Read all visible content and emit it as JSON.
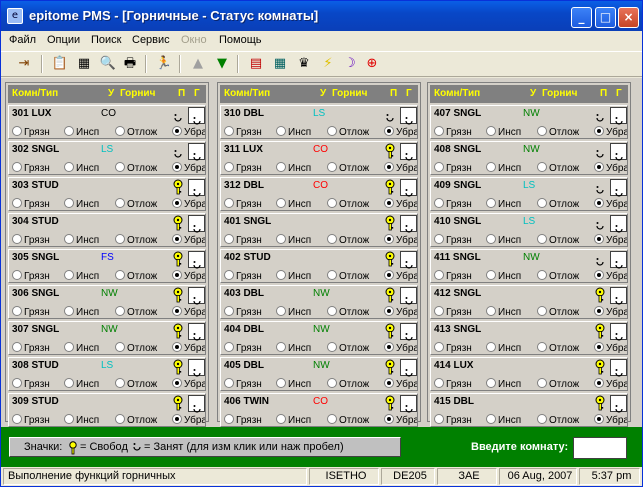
{
  "window": {
    "title": "epitome PMS - [Горничные - Статус комнаты]",
    "min": "_",
    "max": "□",
    "close": "×"
  },
  "menu": [
    "Файл",
    "Опции",
    "Поиск",
    "Сервис",
    "Окно",
    "Помощь"
  ],
  "columns_header": {
    "room": "Комн/Тип",
    "u": "У",
    "maid": "Горнич",
    "p": "П",
    "g": "Г"
  },
  "radio_labels": [
    "Грязн",
    "Инсп",
    "Отлож",
    "Убран"
  ],
  "colors": {
    "code": {
      "CO": "#ff0000",
      "LS": "#00c0c0",
      "NW": "#008000",
      "FS": "#0000ff"
    }
  },
  "rooms": [
    [
      {
        "id": "301 LUX",
        "code": "CO",
        "code_color": "#000000",
        "key": "none",
        "sel": 3
      },
      {
        "id": "302 SNGL",
        "code": "LS",
        "code_color": "#00c0c0",
        "key": "none",
        "sel": 3
      },
      {
        "id": "303 STUD",
        "code": "",
        "code_color": "#000000",
        "key": "key",
        "sel": 3
      },
      {
        "id": "304 STUD",
        "code": "",
        "code_color": "#000000",
        "key": "key",
        "sel": 3
      },
      {
        "id": "305 SNGL",
        "code": "FS",
        "code_color": "#0000ff",
        "key": "key",
        "sel": 3
      },
      {
        "id": "306 SNGL",
        "code": "NW",
        "code_color": "#008000",
        "key": "key",
        "sel": 3
      },
      {
        "id": "307 SNGL",
        "code": "NW",
        "code_color": "#008000",
        "key": "key",
        "sel": 3
      },
      {
        "id": "308 STUD",
        "code": "LS",
        "code_color": "#00c0c0",
        "key": "key",
        "sel": 3
      },
      {
        "id": "309 STUD",
        "code": "",
        "code_color": "#000000",
        "key": "key",
        "sel": 3
      }
    ],
    [
      {
        "id": "310 DBL",
        "code": "LS",
        "code_color": "#00c0c0",
        "key": "none",
        "sel": 3
      },
      {
        "id": "311 LUX",
        "code": "CO",
        "code_color": "#ff0000",
        "key": "key",
        "sel": 3
      },
      {
        "id": "312 DBL",
        "code": "CO",
        "code_color": "#ff0000",
        "key": "key",
        "sel": 3
      },
      {
        "id": "401 SNGL",
        "code": "",
        "code_color": "#000000",
        "key": "key",
        "sel": 3
      },
      {
        "id": "402 STUD",
        "code": "",
        "code_color": "#000000",
        "key": "key",
        "sel": 3
      },
      {
        "id": "403 DBL",
        "code": "NW",
        "code_color": "#008000",
        "key": "key",
        "sel": 3
      },
      {
        "id": "404 DBL",
        "code": "NW",
        "code_color": "#008000",
        "key": "key",
        "sel": 3
      },
      {
        "id": "405 DBL",
        "code": "NW",
        "code_color": "#008000",
        "key": "key",
        "sel": 3
      },
      {
        "id": "406 TWIN",
        "code": "CO",
        "code_color": "#ff0000",
        "key": "key",
        "sel": 3
      }
    ],
    [
      {
        "id": "407 SNGL",
        "code": "NW",
        "code_color": "#008000",
        "key": "none",
        "sel": 3
      },
      {
        "id": "408 SNGL",
        "code": "NW",
        "code_color": "#008000",
        "key": "none",
        "sel": 3
      },
      {
        "id": "409 SNGL",
        "code": "LS",
        "code_color": "#00c0c0",
        "key": "none",
        "sel": 3
      },
      {
        "id": "410 SNGL",
        "code": "LS",
        "code_color": "#00c0c0",
        "key": "none",
        "sel": 3
      },
      {
        "id": "411 SNGL",
        "code": "NW",
        "code_color": "#008000",
        "key": "none",
        "sel": 3
      },
      {
        "id": "412 SNGL",
        "code": "",
        "code_color": "#000000",
        "key": "key",
        "sel": 3
      },
      {
        "id": "413 SNGL",
        "code": "",
        "code_color": "#000000",
        "key": "key",
        "sel": 3
      },
      {
        "id": "414 LUX",
        "code": "",
        "code_color": "#000000",
        "key": "key",
        "sel": 3
      },
      {
        "id": "415 DBL",
        "code": "",
        "code_color": "#000000",
        "key": "key",
        "sel": 3
      }
    ]
  ],
  "legend": {
    "prefix": "Значки:",
    "free": "= Свобод",
    "busy": "= Занят (для изм клик или наж пробел)"
  },
  "enter_room_label": "Введите комнату:",
  "status": [
    "Выполнение функций горничных",
    "ISETHO",
    "DE205",
    "ЗАЕ",
    "06 Aug, 2007",
    "5:37 pm"
  ]
}
